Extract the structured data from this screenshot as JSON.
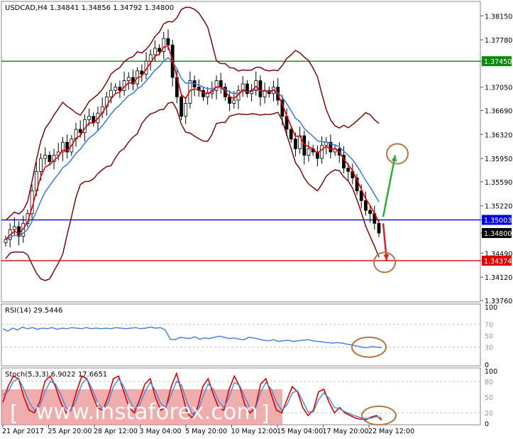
{
  "symbol_header": "USDCAD,H4  1.34841 1.34856 1.34792 1.34800",
  "watermark": "www.instaforex.com",
  "colors": {
    "price": "#000000",
    "ema_fast": "#e00000",
    "ema_slow": "#3a78d8",
    "bollinger": "#7a0a0a",
    "support_line": "#e00000",
    "pivot_line": "#0000dd",
    "resistance_line": "#0a8a0a",
    "rsi": "#4a86d8",
    "stoch_main": "#e00000",
    "stoch_signal": "#4a86d8",
    "arrow_up": "#22b33a",
    "arrow_down": "#e02020",
    "circle": "#b0784a"
  },
  "chart_data": [
    {
      "type": "candlestick",
      "title": "USDCAD,H4",
      "ohlc_last": {
        "open": 1.34841,
        "high": 1.34856,
        "low": 1.34792,
        "close": 1.348
      },
      "y_ticks": [
        "1.38150",
        "1.37780",
        "1.37450",
        "1.37050",
        "1.36690",
        "1.36320",
        "1.35950",
        "1.35590",
        "1.35220",
        "1.35003",
        "1.34800",
        "1.34490",
        "1.34374",
        "1.34120",
        "1.33760"
      ],
      "ylim": [
        1.3376,
        1.3835
      ],
      "x_ticks": [
        "21 Apr 2017",
        "25 Apr 20:00",
        "28 Apr 12:00",
        "3 May 04:00",
        "5 May 20:00",
        "10 May 12:00",
        "15 May 04:00",
        "17 May 20:00",
        "22 May 12:00"
      ],
      "levels": [
        {
          "label": "1.37450",
          "value": 1.3745,
          "role": "resistance"
        },
        {
          "label": "1.35003",
          "value": 1.35003,
          "role": "pivot"
        },
        {
          "label": "1.34374",
          "value": 1.34374,
          "role": "support"
        }
      ],
      "current_price_label": "1.34800",
      "close_series": [
        1.347,
        1.3485,
        1.349,
        1.3475,
        1.3495,
        1.351,
        1.3545,
        1.3575,
        1.3595,
        1.36,
        1.359,
        1.36,
        1.3605,
        1.362,
        1.3605,
        1.3625,
        1.364,
        1.3635,
        1.3655,
        1.366,
        1.365,
        1.3665,
        1.3675,
        1.369,
        1.37,
        1.3705,
        1.37,
        1.3715,
        1.372,
        1.371,
        1.373,
        1.3725,
        1.3745,
        1.3755,
        1.3765,
        1.376,
        1.378,
        1.377,
        1.372,
        1.369,
        1.366,
        1.368,
        1.3715,
        1.3705,
        1.37,
        1.369,
        1.3695,
        1.37,
        1.3715,
        1.3705,
        1.369,
        1.368,
        1.3685,
        1.37,
        1.371,
        1.3695,
        1.37,
        1.3715,
        1.369,
        1.37,
        1.3695,
        1.3705,
        1.3685,
        1.366,
        1.364,
        1.3625,
        1.361,
        1.363,
        1.36,
        1.361,
        1.3605,
        1.3595,
        1.3615,
        1.362,
        1.3605,
        1.361,
        1.36,
        1.358,
        1.3575,
        1.3565,
        1.3545,
        1.353,
        1.3515,
        1.351,
        1.3495,
        1.348
      ],
      "arrows": [
        {
          "direction": "up",
          "from": 1.3505,
          "to": 1.36
        },
        {
          "direction": "down",
          "from": 1.3495,
          "to": 1.3438
        }
      ]
    },
    {
      "type": "line",
      "title": "RSI(14) 29.5446",
      "series": [
        {
          "name": "RSI(14)",
          "values": [
            62,
            58,
            63,
            60,
            65,
            62,
            64,
            61,
            63,
            62,
            64,
            61,
            63,
            62,
            64,
            63,
            62,
            64,
            62,
            63,
            62,
            63,
            62,
            64,
            63,
            62,
            63,
            64,
            62,
            63,
            65,
            63,
            64,
            60,
            44,
            43,
            47,
            46,
            45,
            48,
            44,
            46,
            45,
            47,
            49,
            47,
            45,
            46,
            44,
            43,
            47,
            46,
            44,
            42,
            41,
            43,
            40,
            41,
            42,
            40,
            41,
            42,
            43,
            41,
            40,
            39,
            38,
            37,
            38,
            37,
            35,
            34,
            32,
            30,
            29,
            31,
            30,
            29
          ]
        }
      ],
      "y_ticks": [
        "100",
        "70",
        "50",
        "30",
        "0"
      ],
      "ylim": [
        0,
        100
      ]
    },
    {
      "type": "line",
      "title": "Stoch(5,3,3) 6.9022 17.6651",
      "series": [
        {
          "name": "Stoch main",
          "values": [
            40,
            70,
            90,
            85,
            50,
            25,
            20,
            40,
            80,
            90,
            70,
            40,
            20,
            25,
            60,
            90,
            85,
            55,
            30,
            25,
            50,
            85,
            90,
            60,
            30,
            20,
            45,
            75,
            85,
            50,
            25,
            30,
            70,
            95,
            60,
            20,
            10,
            30,
            70,
            85,
            55,
            30,
            25,
            65,
            90,
            70,
            35,
            20,
            30,
            75,
            85,
            55,
            25,
            20,
            45,
            70,
            60,
            30,
            15,
            25,
            60,
            65,
            40,
            20,
            30,
            20,
            15,
            10,
            8,
            7,
            12,
            15,
            6
          ]
        },
        {
          "name": "Stoch signal",
          "values": [
            55,
            60,
            80,
            85,
            65,
            40,
            25,
            32,
            60,
            80,
            75,
            55,
            30,
            25,
            45,
            75,
            85,
            65,
            40,
            28,
            38,
            70,
            85,
            70,
            45,
            28,
            35,
            60,
            78,
            62,
            38,
            30,
            55,
            80,
            72,
            40,
            18,
            22,
            50,
            75,
            65,
            42,
            30,
            50,
            78,
            72,
            50,
            28,
            28,
            60,
            78,
            65,
            40,
            25,
            35,
            58,
            62,
            42,
            22,
            22,
            45,
            58,
            48,
            30,
            28,
            22,
            18,
            14,
            11,
            9,
            10,
            13,
            10
          ]
        }
      ],
      "y_ticks": [
        "100",
        "80",
        "50",
        "20",
        "0"
      ],
      "ylim": [
        0,
        100
      ]
    }
  ]
}
